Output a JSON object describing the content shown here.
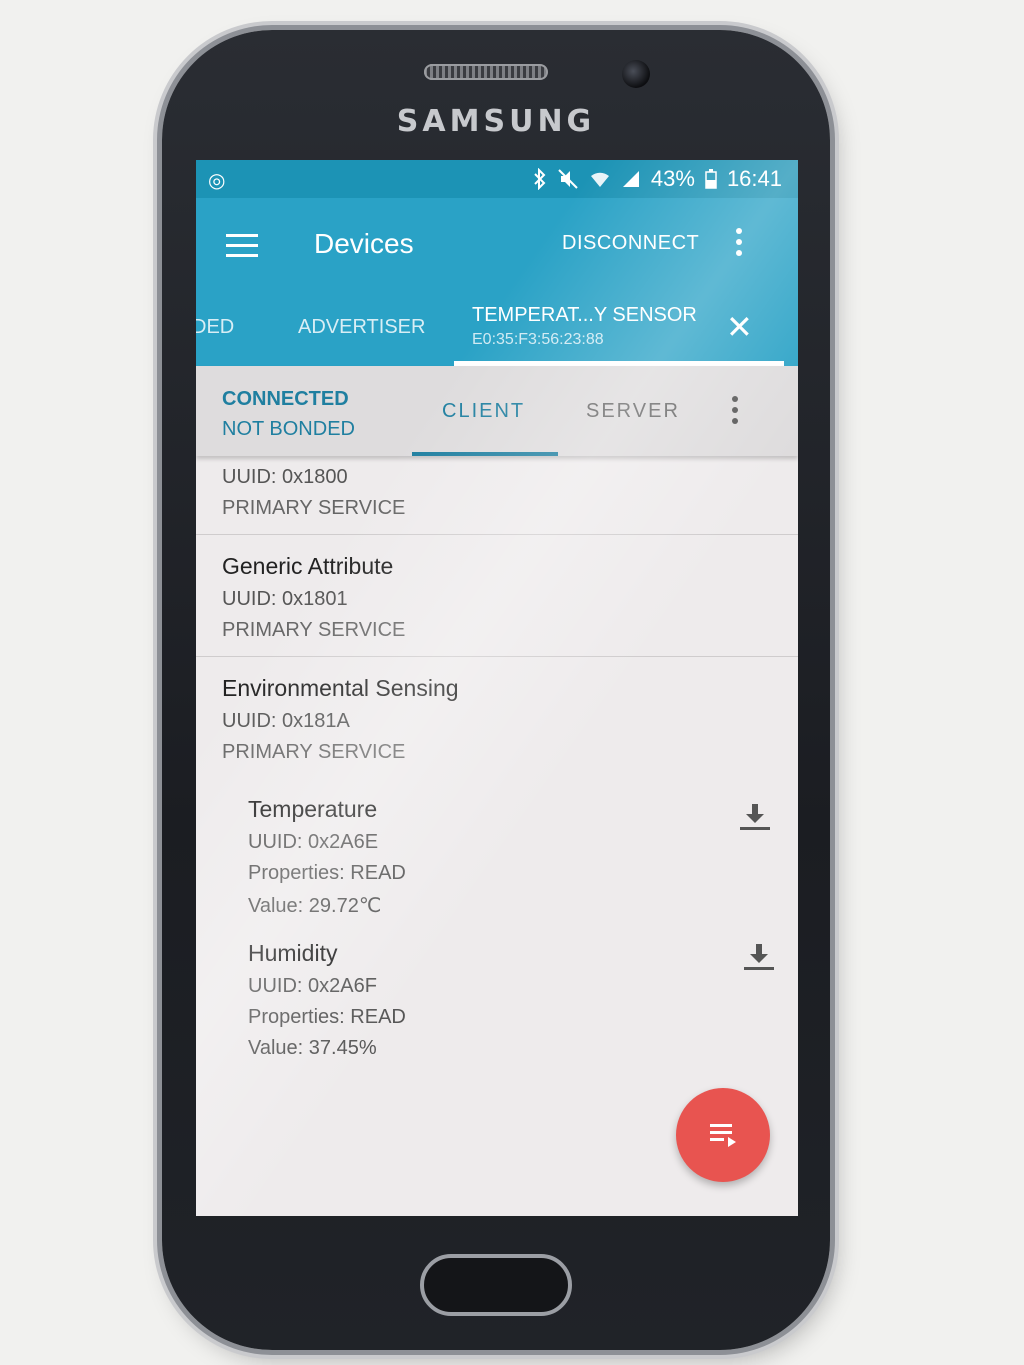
{
  "device": {
    "brand": "SAMSUNG"
  },
  "statusbar": {
    "icons": [
      "bluetooth-icon",
      "mute-icon",
      "wifi-icon",
      "signal-icon"
    ],
    "battery": "43%",
    "time": "16:41"
  },
  "appbar": {
    "title": "Devices",
    "disconnect_label": "DISCONNECT"
  },
  "device_tabs": {
    "partial_tab": "DED",
    "advertiser": "ADVERTISER",
    "active_name": "TEMPERAT...Y SENSOR",
    "active_address": "E0:35:F3:56:23:88"
  },
  "connection": {
    "state": "CONNECTED",
    "bond": "NOT BONDED",
    "tab_client": "CLIENT",
    "tab_server": "SERVER"
  },
  "services": [
    {
      "name": "",
      "uuid": "0x1800",
      "type": "PRIMARY SERVICE"
    },
    {
      "name": "Generic Attribute",
      "uuid": "0x1801",
      "type": "PRIMARY SERVICE"
    },
    {
      "name": "Environmental Sensing",
      "uuid": "0x181A",
      "type": "PRIMARY SERVICE",
      "characteristics": [
        {
          "name": "Temperature",
          "uuid": "0x2A6E",
          "properties": "READ",
          "value": "29.72℃"
        },
        {
          "name": "Humidity",
          "uuid": "0x2A6F",
          "properties": "READ",
          "value": "37.45%"
        }
      ]
    }
  ],
  "labels": {
    "uuid": "UUID:",
    "properties": "Properties:",
    "value": "Value:"
  },
  "colors": {
    "primary": "#2aa2c6",
    "status_bar": "#1c93b5",
    "accent": "#1f7fa0",
    "fab": "#e85450"
  }
}
